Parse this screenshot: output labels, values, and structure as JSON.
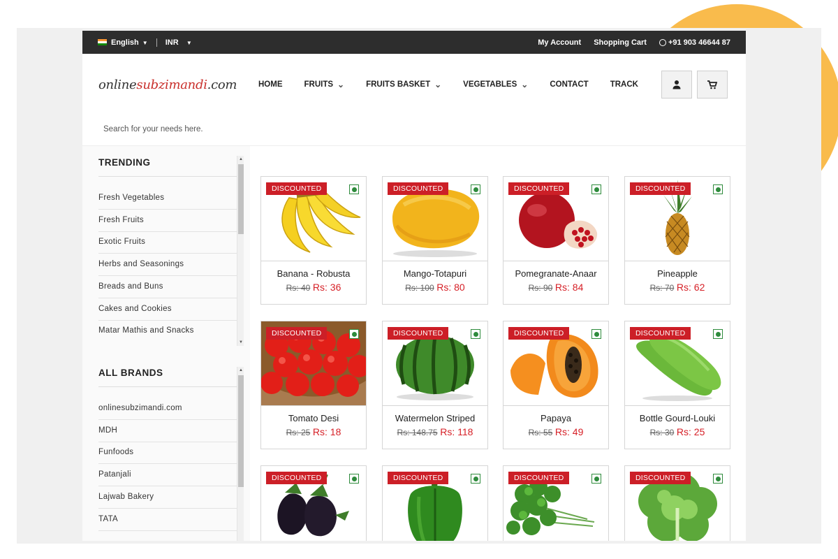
{
  "topbar": {
    "language": "English",
    "currency": "INR",
    "my_account": "My Account",
    "shopping_cart": "Shopping Cart",
    "phone": "+91 903 46644 87"
  },
  "header": {
    "logo_prefix": "online",
    "logo_highlight": "subzimandi",
    "logo_suffix": ".com",
    "nav": [
      {
        "label": "HOME",
        "dropdown": false
      },
      {
        "label": "FRUITS",
        "dropdown": true
      },
      {
        "label": "FRUITS BASKET",
        "dropdown": true
      },
      {
        "label": "VEGETABLES",
        "dropdown": true
      },
      {
        "label": "CONTACT",
        "dropdown": false
      },
      {
        "label": "TRACK",
        "dropdown": false
      }
    ],
    "search_placeholder": "Search for your needs here."
  },
  "sidebar": {
    "trending_title": "TRENDING",
    "trending": [
      "Fresh Vegetables",
      "Fresh Fruits",
      "Exotic Fruits",
      "Herbs and Seasonings",
      "Breads and Buns",
      "Cakes and Cookies",
      "Matar Mathis and Snacks"
    ],
    "brands_title": "ALL BRANDS",
    "brands": [
      "onlinesubzimandi.com",
      "MDH",
      "Funfoods",
      "Patanjali",
      "Lajwab Bakery",
      "TATA"
    ]
  },
  "products": [
    {
      "badge": "DISCOUNTED",
      "name": "Banana - Robusta",
      "old_price": "Rs: 40",
      "new_price": "Rs: 36",
      "image": "banana"
    },
    {
      "badge": "DISCOUNTED",
      "name": "Mango-Totapuri",
      "old_price": "Rs: 100",
      "new_price": "Rs: 80",
      "image": "mango"
    },
    {
      "badge": "DISCOUNTED",
      "name": "Pomegranate-Anaar",
      "old_price": "Rs: 90",
      "new_price": "Rs: 84",
      "image": "pomegranate"
    },
    {
      "badge": "DISCOUNTED",
      "name": "Pineapple",
      "old_price": "Rs: 70",
      "new_price": "Rs: 62",
      "image": "pineapple"
    },
    {
      "badge": "DISCOUNTED",
      "name": "Tomato Desi",
      "old_price": "Rs: 25",
      "new_price": "Rs: 18",
      "image": "tomato"
    },
    {
      "badge": "DISCOUNTED",
      "name": "Watermelon Striped",
      "old_price": "Rs: 148.75",
      "new_price": "Rs: 118",
      "image": "watermelon"
    },
    {
      "badge": "DISCOUNTED",
      "name": "Papaya",
      "old_price": "Rs: 55",
      "new_price": "Rs: 49",
      "image": "papaya"
    },
    {
      "badge": "DISCOUNTED",
      "name": "Bottle Gourd-Louki",
      "old_price": "Rs: 30",
      "new_price": "Rs: 25",
      "image": "bottle-gourd"
    },
    {
      "badge": "DISCOUNTED",
      "name": "",
      "old_price": "",
      "new_price": "",
      "image": "brinjal"
    },
    {
      "badge": "DISCOUNTED",
      "name": "",
      "old_price": "",
      "new_price": "",
      "image": "capsicum"
    },
    {
      "badge": "DISCOUNTED",
      "name": "",
      "old_price": "",
      "new_price": "",
      "image": "coriander"
    },
    {
      "badge": "DISCOUNTED",
      "name": "",
      "old_price": "",
      "new_price": "",
      "image": "lettuce"
    }
  ],
  "colors": {
    "accent_red": "#cc1f27",
    "topbar_bg": "#2d2d2d",
    "veg_green": "#2e8b3c",
    "decor_orange": "#f9bb4c"
  }
}
